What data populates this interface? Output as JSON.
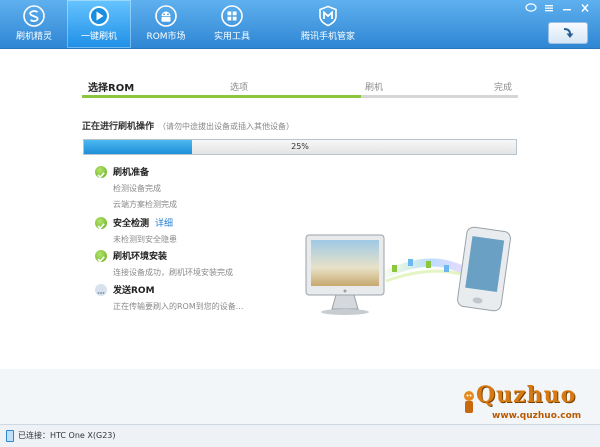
{
  "nav": {
    "items": [
      {
        "label": "刷机精灵",
        "icon": "s-logo-icon"
      },
      {
        "label": "一键刷机",
        "icon": "play-icon",
        "active": true
      },
      {
        "label": "ROM市场",
        "icon": "android-icon"
      },
      {
        "label": "实用工具",
        "icon": "grid-icon"
      },
      {
        "label": "腾讯手机管家",
        "icon": "shield-icon"
      }
    ]
  },
  "window_controls": [
    "feedback-icon",
    "menu-icon",
    "minimize-icon",
    "close-icon"
  ],
  "steps": {
    "labels": [
      "选择ROM",
      "选项",
      "刷机",
      "完成"
    ],
    "current": 0,
    "progress": 0.64
  },
  "operation": {
    "title": "正在进行刷机操作",
    "hint": "（请勿中途拔出设备或插入其他设备）",
    "percent": 0.25,
    "percent_label": "25%"
  },
  "checklist": [
    {
      "title": "刷机准备",
      "status": "done",
      "details": [
        "检测设备完成",
        "云端方案检测完成"
      ]
    },
    {
      "title": "安全检测",
      "status": "done",
      "link": "详细",
      "details": [
        "未检测到安全隐患"
      ]
    },
    {
      "title": "刷机环境安装",
      "status": "done",
      "details": [
        "连接设备成功，刷机环境安装完成"
      ]
    },
    {
      "title": "发送ROM",
      "status": "pending",
      "details": [
        "正在传输要刷入的ROM到您的设备..."
      ]
    }
  ],
  "status": {
    "connected": "已连接：HTC One X(G23)"
  },
  "watermark": {
    "logo": "Quzhuo",
    "url": "www.quzhuo.com"
  },
  "colors": {
    "accent": "#2f86d3",
    "step_fill": "#8cc63e",
    "progress": "#1e8fd8"
  }
}
